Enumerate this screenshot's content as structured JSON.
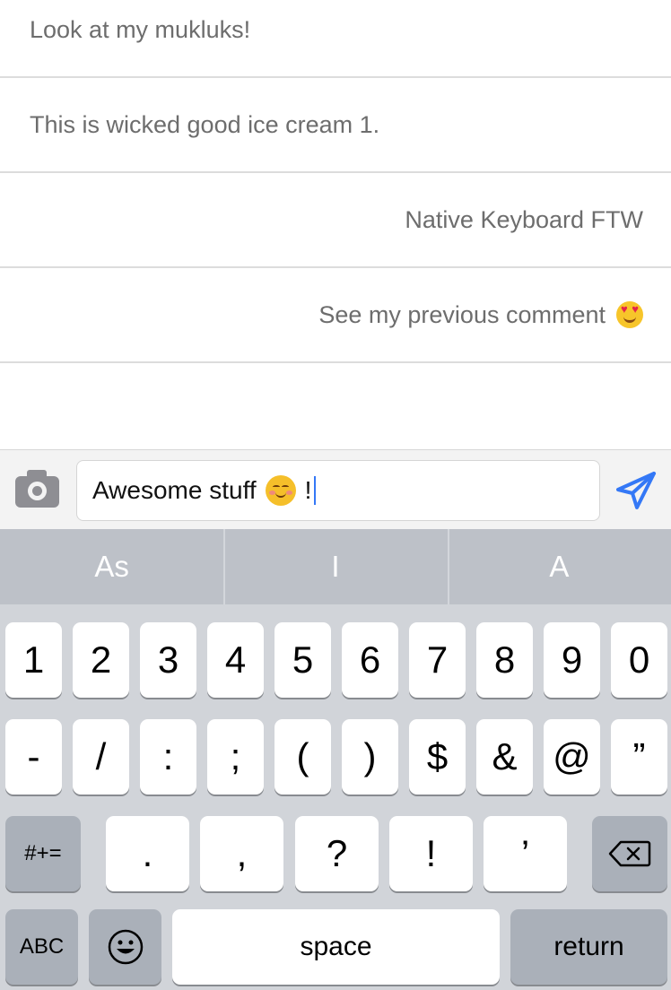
{
  "messages": [
    {
      "text": "Look at my mukluks!",
      "align": "left"
    },
    {
      "text": "This is wicked good ice cream 1.",
      "align": "left"
    },
    {
      "text": "Native Keyboard FTW",
      "align": "right"
    },
    {
      "text": "See my previous comment",
      "align": "right",
      "emoji": "heart-eyes-emoji"
    }
  ],
  "composer": {
    "text_before": "Awesome stuff",
    "emoji": "smiling-face-emoji",
    "text_after": "!",
    "camera_icon": "camera-icon",
    "send_icon": "send-icon"
  },
  "predictive": [
    "As",
    "I",
    "A"
  ],
  "keyboard": {
    "row1": [
      "1",
      "2",
      "3",
      "4",
      "5",
      "6",
      "7",
      "8",
      "9",
      "0"
    ],
    "row2": [
      "-",
      "/",
      ":",
      ";",
      "(",
      ")",
      "$",
      "&",
      "@",
      "”"
    ],
    "row3": {
      "switch": "#+=",
      "keys": [
        ".",
        ",",
        "?",
        "!",
        "’"
      ],
      "delete_icon": "backspace-icon"
    },
    "row4": {
      "abc": "ABC",
      "emoji_icon": "emoji-icon",
      "space": "space",
      "return": "return"
    }
  },
  "colors": {
    "accent": "#3478f6",
    "keyboard_bg": "#d1d4d9",
    "predictive_bg": "#bdc1c8",
    "message_text": "#6d6d6d"
  }
}
